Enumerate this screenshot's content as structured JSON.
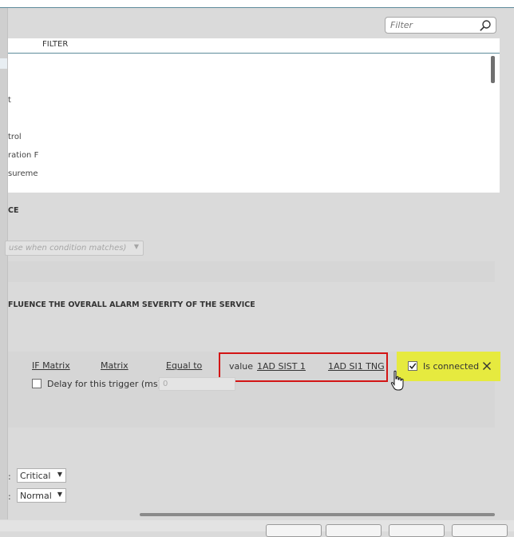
{
  "filter": {
    "placeholder": "Filter"
  },
  "list": {
    "header": "FILTER",
    "items": [
      "t",
      "trol",
      "ration F",
      "sureme"
    ]
  },
  "sections": {
    "ce": "CE",
    "influence": "FLUENCE THE OVERALL ALARM SEVERITY OF THE SERVICE"
  },
  "action_dropdown": {
    "value": "use when condition matches)"
  },
  "trigger": {
    "col1": "IF Matrix",
    "col2": "Matrix",
    "operator": "Equal to",
    "value_label": "value",
    "value1": "1AD SIST 1",
    "value2": "1AD SI1 TNG",
    "is_connected_label": "Is connected",
    "delay_label": "Delay for this trigger (ms):",
    "delay_value": "0"
  },
  "severity": {
    "critical": "Critical",
    "normal": "Normal"
  },
  "colors": {
    "highlight": "#e6ea3f",
    "focus_box": "#d31515"
  }
}
